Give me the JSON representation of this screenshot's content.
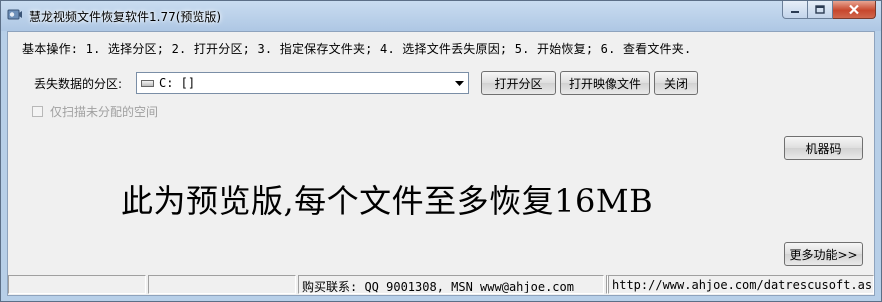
{
  "window": {
    "title": "慧龙视频文件恢复软件1.77(预览版)"
  },
  "steps_text": "基本操作: 1. 选择分区; 2. 打开分区; 3. 指定保存文件夹; 4. 选择文件丢失原因; 5. 开始恢复; 6. 查看文件夹.",
  "partition": {
    "label": "丢失数据的分区:",
    "selected": "C: []",
    "drive_icon": "hard-drive-icon"
  },
  "buttons": {
    "open_partition": "打开分区",
    "open_image": "打开映像文件",
    "close": "关闭",
    "machine_code": "机器码",
    "more": "更多功能>>"
  },
  "checkbox": {
    "label": "仅扫描未分配的空间",
    "checked": false,
    "enabled": false
  },
  "preview_notice": "此为预览版,每个文件至多恢复16MB",
  "status": {
    "cell1": "",
    "cell2": "",
    "purchase": "购买联系: QQ 9001308, MSN www@ahjoe.com",
    "cell4": "",
    "url": "http://www.ahjoe.com/datrescusoft.asp"
  }
}
